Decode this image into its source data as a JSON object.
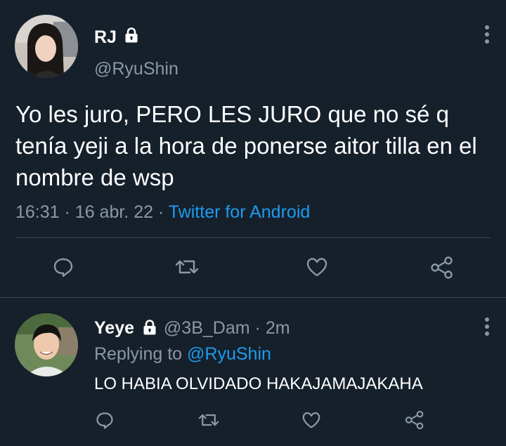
{
  "main_tweet": {
    "display_name": "RJ",
    "handle": "@RyuShin",
    "text": "Yo les juro, PERO LES JURO que no sé q tenía yeji a la hora de ponerse aitor tilla en el nombre de wsp",
    "time": "16:31",
    "date": "16 abr. 22",
    "separator": "·",
    "source": "Twitter for Android",
    "icons": [
      "lock-icon",
      "more-vertical-icon",
      "reply-icon",
      "retweet-icon",
      "like-icon",
      "share-icon"
    ]
  },
  "reply_tweet": {
    "display_name": "Yeye",
    "handle": "@3B_Dam",
    "separator": "·",
    "time_ago": "2m",
    "replying_prefix": "Replying to",
    "replying_to": "@RyuShin",
    "text": "LO HABIA OLVIDADO HAKAJAMAJAKAHA",
    "icons": [
      "lock-icon",
      "more-vertical-icon",
      "reply-icon",
      "retweet-icon",
      "like-icon",
      "share-icon"
    ]
  },
  "colors": {
    "background": "#15202b",
    "text": "#ffffff",
    "muted": "#8b98a5",
    "link": "#1d9bf0",
    "divider": "#38444d"
  }
}
